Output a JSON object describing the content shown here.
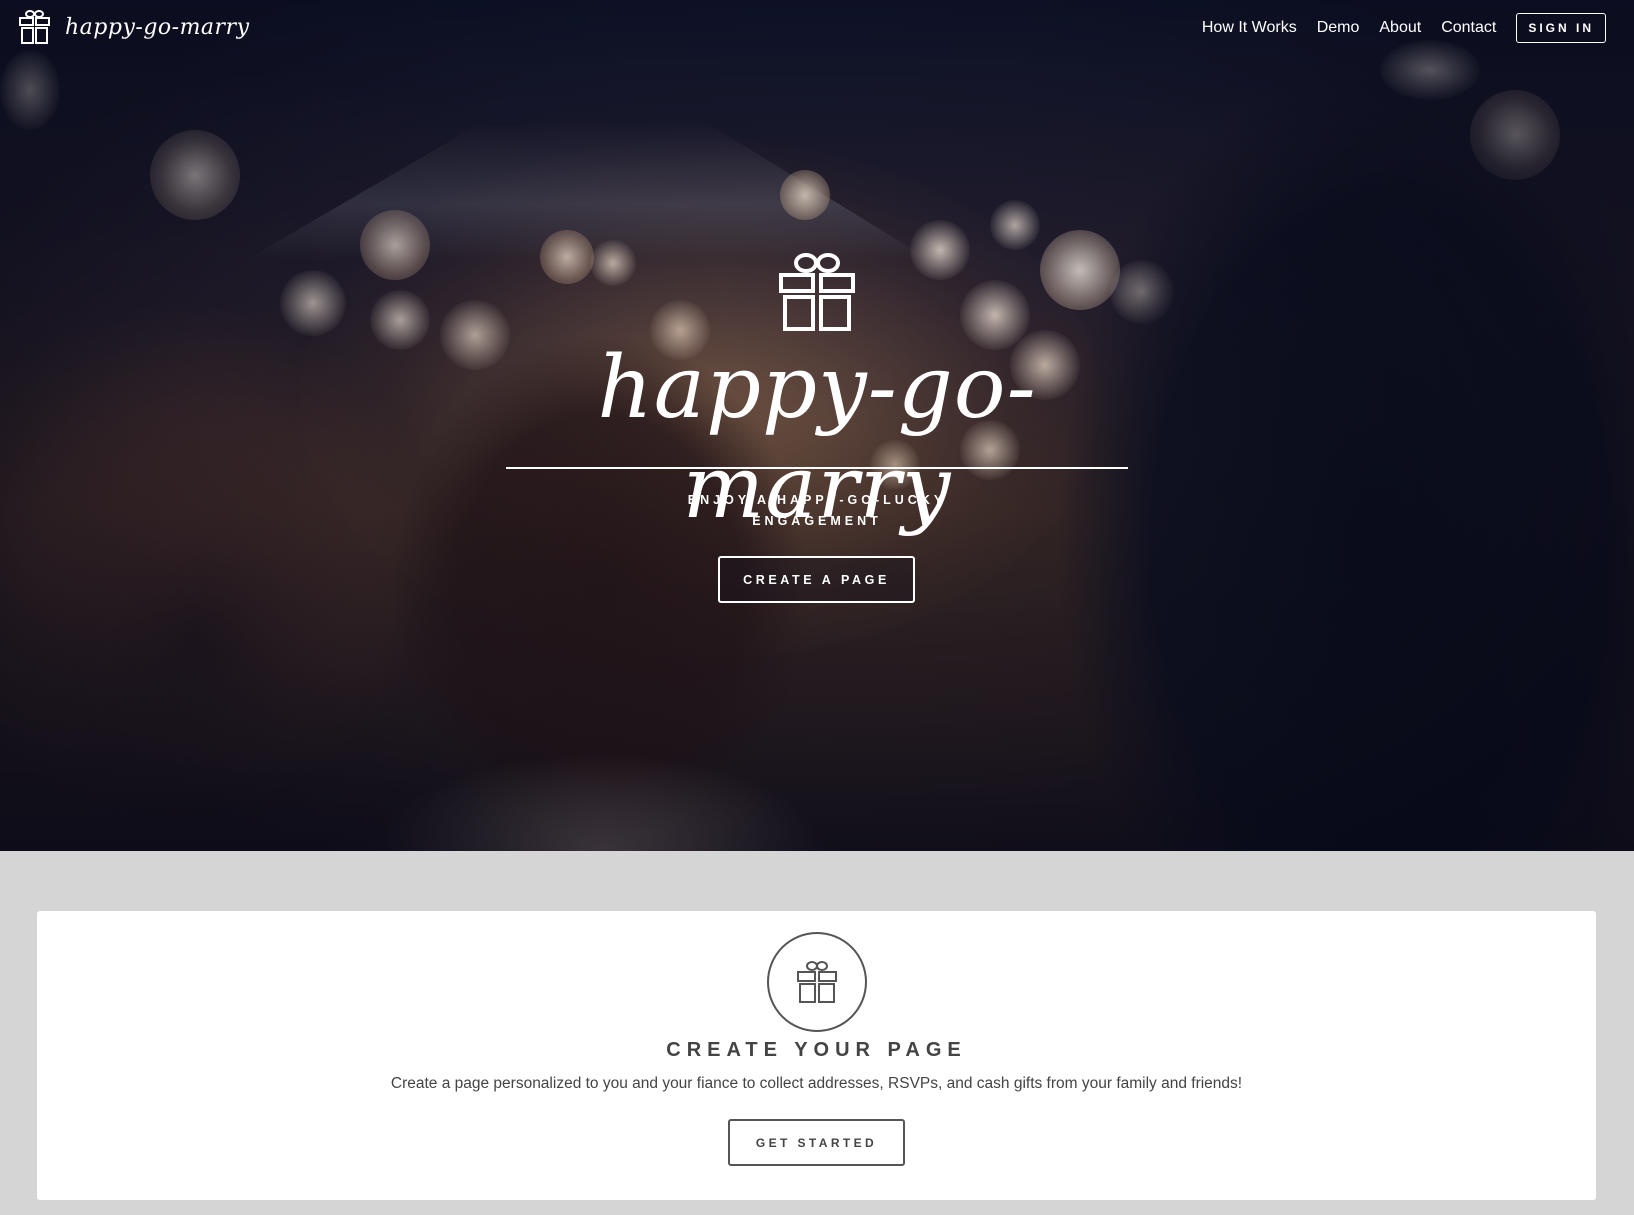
{
  "navbar": {
    "brand_name": "happy-go-marry",
    "brand_icon": "gift-icon",
    "links": [
      {
        "label": "How It Works"
      },
      {
        "label": "Demo"
      },
      {
        "label": "About"
      },
      {
        "label": "Contact"
      }
    ],
    "signin_label": "SIGN IN"
  },
  "hero": {
    "icon": "gift-icon",
    "title": "happy-go-marry",
    "tagline_line1": "ENJOY A HAPPY-GO-LUCKY",
    "tagline_line2": "ENGAGEMENT",
    "cta_label": "CREATE A PAGE"
  },
  "feature_card": {
    "icon": "gift-icon",
    "title": "CREATE YOUR PAGE",
    "description": "Create a page personalized to you and your fiance to collect addresses, RSVPs, and cash gifts from your family and friends!",
    "cta_label": "GET STARTED"
  },
  "colors": {
    "page_background": "#d5d5d5",
    "card_background": "#ffffff",
    "hero_text": "#ffffff",
    "card_text": "#444444"
  }
}
